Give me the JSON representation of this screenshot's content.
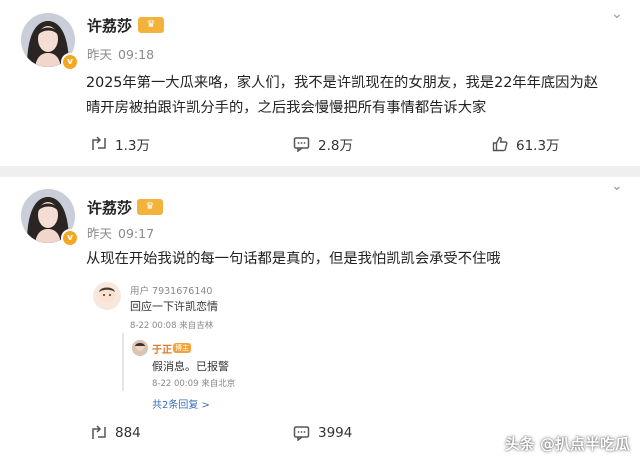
{
  "posts": [
    {
      "username": "许荔莎",
      "time": "09:18",
      "day": "昨天",
      "body_lines": [
        "2025年第一大瓜来咯，家人们，我不是许凯现在的女朋友，我是22年年底因为赵",
        "晴开房被拍跟许凯分手的，之后我会慢慢把所有事情都告诉大家"
      ],
      "reposts": "1.3万",
      "comments": "2.8万",
      "likes": "61.3万"
    },
    {
      "username": "许荔莎",
      "time": "09:17",
      "day": "昨天",
      "body_lines": [
        "从现在开始我说的每一句话都是真的，但是我怕凯凯会承受不住哦"
      ],
      "reposts": "884",
      "comments": "3994",
      "embedded": {
        "user": "用户 7931676140",
        "comment": "回应一下许凯恋情",
        "meta": "8-22 00:08 来自吉林",
        "reply_user": "于正",
        "reply_tag": "博主",
        "reply_text": "假消息。已报警",
        "reply_meta": "8-22 00:09 来自北京",
        "more_replies": "共2条回复 >"
      }
    }
  ],
  "badge_letter": "v",
  "crown_label": "♛",
  "more_glyph": "⌄",
  "watermark": "头条 @扒点半吃瓜",
  "colors": {
    "background": "#efefef",
    "card": "#ffffff",
    "verified": "#f5a623",
    "link": "#3a6fb5"
  }
}
